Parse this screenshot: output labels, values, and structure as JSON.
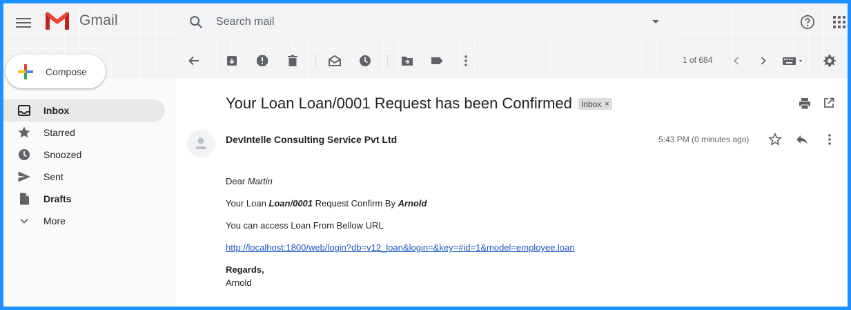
{
  "app": {
    "name": "Gmail"
  },
  "search": {
    "placeholder": "Search mail"
  },
  "compose": {
    "label": "Compose"
  },
  "sidebar": {
    "items": [
      {
        "label": "Inbox",
        "icon": "inbox-icon"
      },
      {
        "label": "Starred",
        "icon": "star-icon"
      },
      {
        "label": "Snoozed",
        "icon": "clock-icon"
      },
      {
        "label": "Sent",
        "icon": "send-icon"
      },
      {
        "label": "Drafts",
        "icon": "draft-icon"
      },
      {
        "label": "More",
        "icon": "chevron-down-icon"
      }
    ]
  },
  "toolbar": {
    "pager": "1 of 684",
    "icons": [
      "back-icon",
      "archive-icon",
      "report-spam-icon",
      "delete-icon",
      "mark-unread-icon",
      "snooze-icon",
      "move-to-icon",
      "label-icon",
      "more-vert-icon",
      "older-icon",
      "newer-icon",
      "keyboard-icon",
      "settings-icon"
    ]
  },
  "message": {
    "subject": "Your Loan Loan/0001 Request has been Confirmed",
    "label": "Inbox",
    "label_close": "×",
    "sender": "DevIntelle Consulting Service Pvt Ltd",
    "time": "5:43 PM (0 minutes ago)",
    "body": {
      "greeting_prefix": "Dear ",
      "greeting_name": "Martin",
      "line2_prefix": "Your Loan ",
      "line2_loan": "Loan/0001",
      "line2_middle": " Request Confirm By ",
      "line2_by": "Arnold",
      "line3": "You can access Loan From Bellow URL",
      "link": "http://localhost:1800/web/login?db=v12_loan&login=&key=#id=1&model=employee.loan",
      "regards": "Regards,",
      "signature": "Arnold"
    }
  },
  "colors": {
    "frame_border": "#1e90ff",
    "link": "#1a56c7",
    "gmail_red": "#ea4335",
    "label_chip": "#dddddd",
    "active_nav": "#e8e8e8"
  }
}
